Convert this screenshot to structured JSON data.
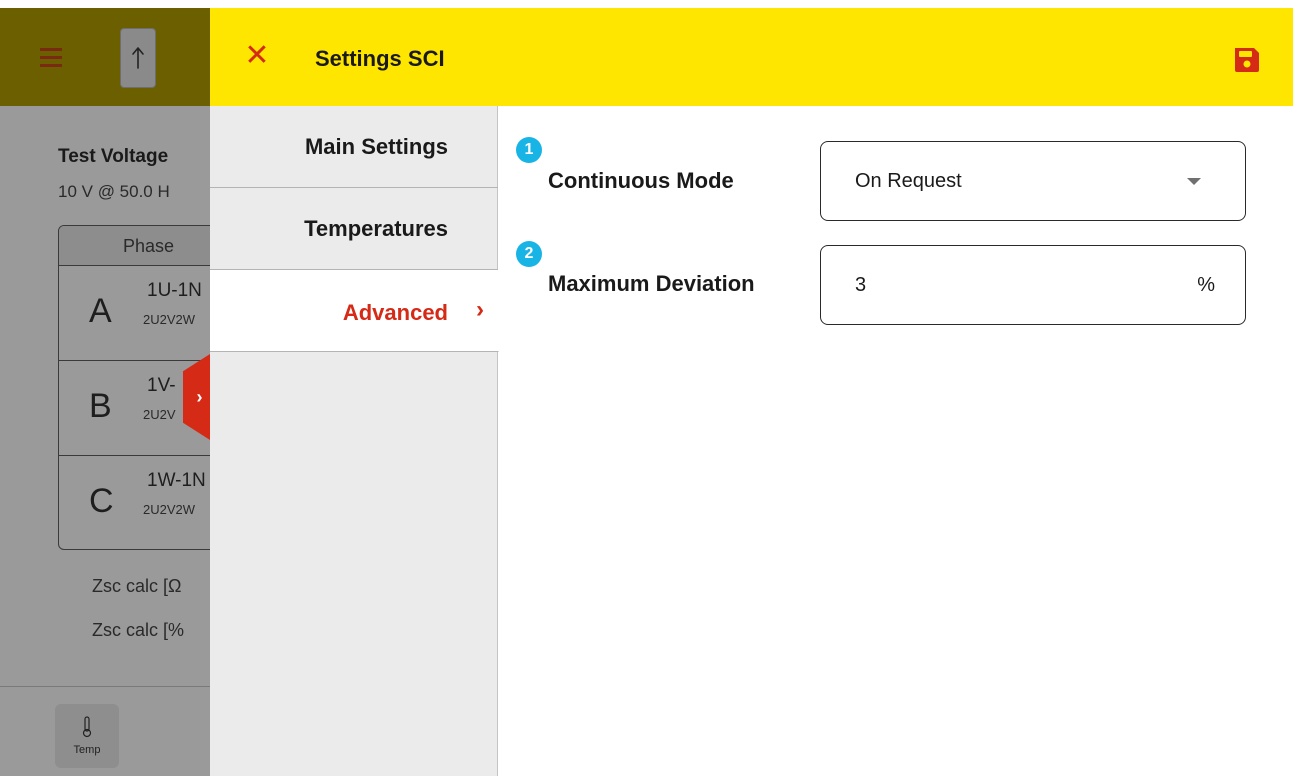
{
  "background": {
    "title": "Test Voltage",
    "subtitle": "10 V @ 50.0 H",
    "table": {
      "header": "Phase",
      "rows": [
        {
          "letter": "A",
          "main": "1U-1N",
          "sub": "2U2V2W"
        },
        {
          "letter": "B",
          "main": "1V-",
          "sub": "2U2V"
        },
        {
          "letter": "C",
          "main": "1W-1N",
          "sub": "2U2V2W"
        }
      ]
    },
    "zsc_ohm": "Zsc calc [Ω",
    "zsc_pct": "Zsc calc [%",
    "temp_label": "Temp",
    "colors": {
      "overlay": "#9a9a9a",
      "drawer_tab": "#d42a16"
    }
  },
  "header": {
    "title": "Settings SCI",
    "close_icon": "close-icon",
    "save_icon": "save-icon",
    "color": "#ffe600",
    "accent": "#d42a16"
  },
  "menu": {
    "items": [
      {
        "label": "Main Settings"
      },
      {
        "label": "Temperatures"
      },
      {
        "label": "Advanced",
        "active": true
      }
    ]
  },
  "form": {
    "fields": [
      {
        "badge": "1",
        "label": "Continuous Mode",
        "value": "On Request",
        "type": "select"
      },
      {
        "badge": "2",
        "label": "Maximum Deviation",
        "value": "3",
        "unit": "%",
        "type": "number"
      }
    ],
    "badge_color": "#18b4e6"
  }
}
